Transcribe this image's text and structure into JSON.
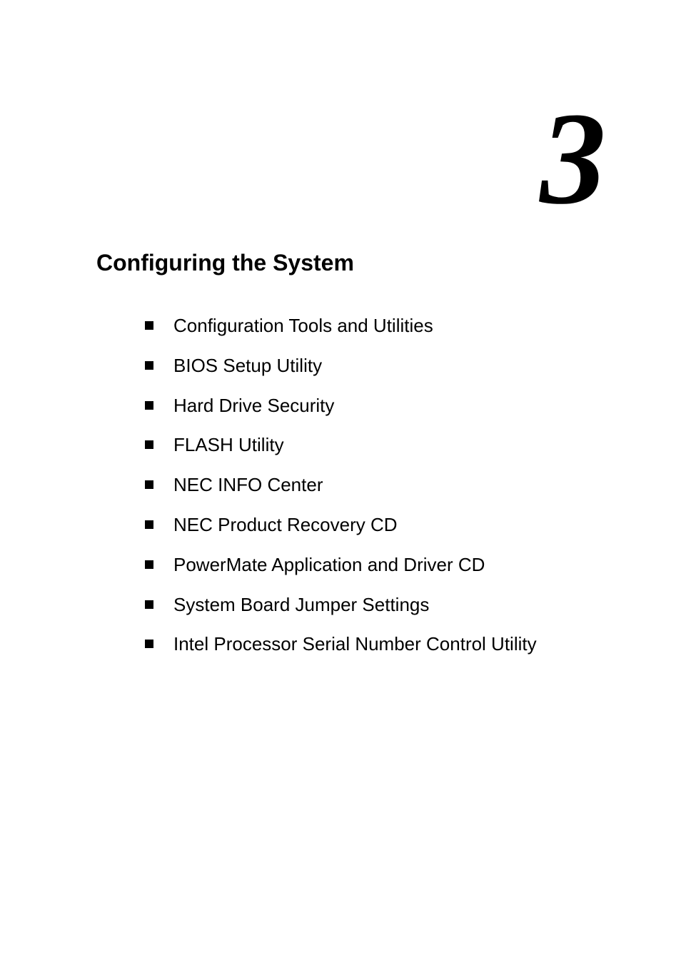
{
  "chapter": {
    "number": "3",
    "title": "Configuring the System",
    "topics": [
      "Configuration Tools and Utilities",
      "BIOS Setup Utility",
      "Hard Drive Security",
      "FLASH Utility",
      "NEC INFO Center",
      "NEC Product Recovery CD",
      "PowerMate Application and Driver CD",
      "System Board Jumper Settings",
      "Intel Processor Serial Number Control Utility"
    ]
  }
}
